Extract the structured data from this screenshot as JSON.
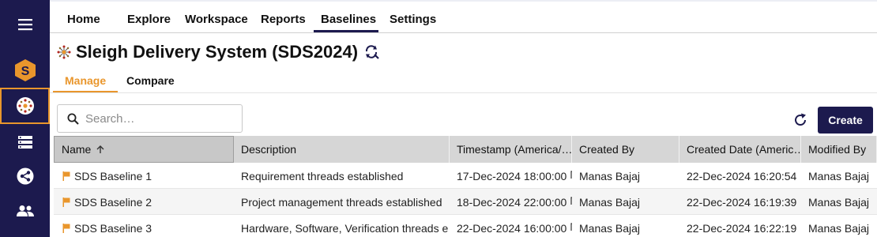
{
  "nav": {
    "items": [
      "Home",
      "Explore",
      "Workspace",
      "Reports",
      "Baselines",
      "Settings"
    ],
    "active": "Baselines"
  },
  "rail": {
    "icons": [
      "menu-icon",
      "logo-icon",
      "system-icon",
      "list-icon",
      "share-icon",
      "users-icon"
    ],
    "active": "system-icon"
  },
  "page": {
    "title": "Sleigh Delivery System (SDS2024)"
  },
  "subtabs": {
    "manage": "Manage",
    "compare": "Compare",
    "active": "Manage"
  },
  "search": {
    "placeholder": "Search…",
    "value": ""
  },
  "toolbar": {
    "create_label": "Create"
  },
  "table": {
    "columns": [
      "Name",
      "Description",
      "Timestamp (America/…",
      "Created By",
      "Created Date (Americ…",
      "Modified By"
    ],
    "sort": {
      "column": "Name",
      "direction": "ascending"
    },
    "rows": [
      [
        "SDS Baseline 1",
        "Requirement threads established",
        "17-Dec-2024 18:00:00",
        "Manas Bajaj",
        "22-Dec-2024 16:20:54",
        "Manas Bajaj"
      ],
      [
        "SDS Baseline 2",
        "Project management threads established",
        "18-Dec-2024 22:00:00",
        "Manas Bajaj",
        "22-Dec-2024 16:19:39",
        "Manas Bajaj"
      ],
      [
        "SDS Baseline 3",
        "Hardware, Software, Verification threads e…",
        "22-Dec-2024 16:00:00",
        "Manas Bajaj",
        "22-Dec-2024 16:22:19",
        "Manas Bajaj"
      ]
    ]
  },
  "colors": {
    "brand_navy": "#1c1a4e",
    "accent_orange": "#e9962c",
    "header_gray": "#d6d6d6"
  }
}
